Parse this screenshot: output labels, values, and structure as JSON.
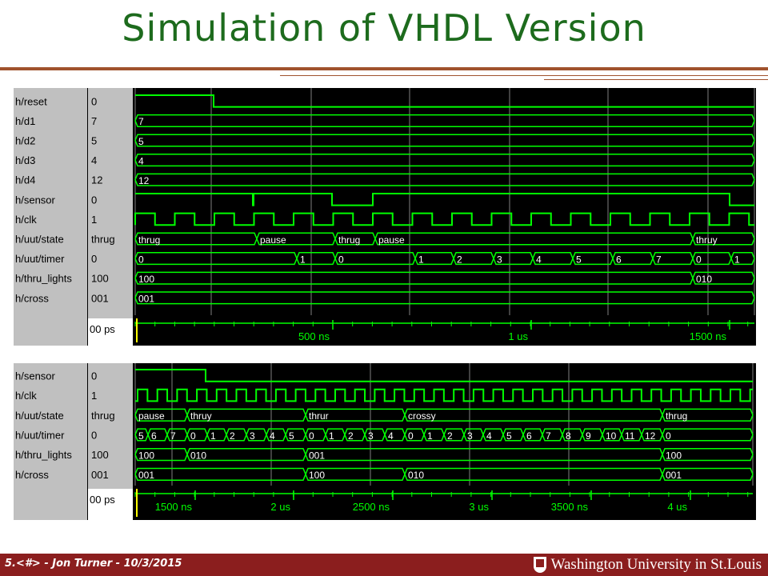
{
  "slide": {
    "title": "Simulation of VHDL Version",
    "footer": "5.<#> - Jon Turner - 10/3/2015",
    "institution": "Washington University in St.Louis"
  },
  "colors": {
    "wave": "#00ff00",
    "title": "#1d6b1d",
    "accent": "#a0522d",
    "footer": "#8b1e1e"
  },
  "panels": [
    {
      "id": "top",
      "signals": [
        {
          "name": "h/reset",
          "value": "0",
          "kind": "bit",
          "edges": [
            [
              0,
              1
            ],
            [
              98,
              0
            ]
          ]
        },
        {
          "name": "h/d1",
          "value": "7",
          "kind": "bus",
          "segs": [
            [
              0,
              "7"
            ]
          ]
        },
        {
          "name": "h/d2",
          "value": "5",
          "kind": "bus",
          "segs": [
            [
              0,
              "5"
            ]
          ]
        },
        {
          "name": "h/d3",
          "value": "4",
          "kind": "bus",
          "segs": [
            [
              0,
              "4"
            ]
          ]
        },
        {
          "name": "h/d4",
          "value": "12",
          "kind": "bus",
          "segs": [
            [
              0,
              "12"
            ]
          ]
        },
        {
          "name": "h/sensor",
          "value": "0",
          "kind": "bit",
          "edges": [
            [
              0,
              1
            ],
            [
              147,
              0
            ],
            [
              148,
              1
            ],
            [
              246,
              0
            ],
            [
              297,
              1
            ],
            [
              743,
              0
            ]
          ]
        },
        {
          "name": "h/clk",
          "value": "1",
          "kind": "clock",
          "start": 0,
          "period": 49.5
        },
        {
          "name": "h/uut/state",
          "value": "thrug",
          "kind": "bus",
          "segs": [
            [
              0,
              "thrug"
            ],
            [
              152,
              "pause"
            ],
            [
              250,
              "thrug"
            ],
            [
              300,
              "pause"
            ],
            [
              697,
              "thruy"
            ]
          ]
        },
        {
          "name": "h/uut/timer",
          "value": "0",
          "kind": "bus",
          "segs": [
            [
              0,
              "0"
            ],
            [
              202,
              "1"
            ],
            [
              250,
              "0"
            ],
            [
              350,
              "1"
            ],
            [
              398,
              "2"
            ],
            [
              448,
              "3"
            ],
            [
              497,
              "4"
            ],
            [
              547,
              "5"
            ],
            [
              597,
              "6"
            ],
            [
              647,
              "7"
            ],
            [
              697,
              "0"
            ],
            [
              745,
              "1"
            ]
          ]
        },
        {
          "name": "h/thru_lights",
          "value": "100",
          "kind": "bus",
          "segs": [
            [
              0,
              "100"
            ],
            [
              697,
              "010"
            ]
          ]
        },
        {
          "name": "h/cross",
          "value": "001",
          "kind": "bus",
          "segs": [
            [
              0,
              "001"
            ]
          ]
        }
      ],
      "time": {
        "cursor": "00 ps",
        "ticks": [
          {
            "at": 247,
            "label": "500 ns"
          },
          {
            "at": 495,
            "label": "1 us"
          },
          {
            "at": 743,
            "label": "1500 ns"
          }
        ]
      }
    },
    {
      "id": "bottom",
      "signals": [
        {
          "name": "h/sensor",
          "value": "0",
          "kind": "bit",
          "edges": [
            [
              0,
              1
            ],
            [
              88,
              0
            ]
          ]
        },
        {
          "name": "h/clk",
          "value": "1",
          "kind": "clock",
          "start": 3,
          "period": 24.7
        },
        {
          "name": "h/uut/state",
          "value": "thrug",
          "kind": "bus",
          "segs": [
            [
              0,
              "pause"
            ],
            [
              65,
              "thruy"
            ],
            [
              213,
              "thrur"
            ],
            [
              337,
              "crossy"
            ],
            [
              659,
              "thrug"
            ]
          ]
        },
        {
          "name": "h/uut/timer",
          "value": "0",
          "kind": "bus",
          "segs": [
            [
              0,
              "5"
            ],
            [
              16,
              "6"
            ],
            [
              40,
              "7"
            ],
            [
              65,
              "0"
            ],
            [
              90,
              "1"
            ],
            [
              114,
              "2"
            ],
            [
              139,
              "3"
            ],
            [
              164,
              "4"
            ],
            [
              188,
              "5"
            ],
            [
              213,
              "0"
            ],
            [
              238,
              "1"
            ],
            [
              262,
              "2"
            ],
            [
              287,
              "3"
            ],
            [
              312,
              "4"
            ],
            [
              337,
              "0"
            ],
            [
              361,
              "1"
            ],
            [
              386,
              "2"
            ],
            [
              411,
              "3"
            ],
            [
              435,
              "4"
            ],
            [
              460,
              "5"
            ],
            [
              485,
              "6"
            ],
            [
              509,
              "7"
            ],
            [
              534,
              "8"
            ],
            [
              559,
              "9"
            ],
            [
              584,
              "10"
            ],
            [
              608,
              "11"
            ],
            [
              633,
              "12"
            ],
            [
              659,
              "0"
            ]
          ]
        },
        {
          "name": "h/thru_lights",
          "value": "100",
          "kind": "bus",
          "segs": [
            [
              0,
              "100"
            ],
            [
              65,
              "010"
            ],
            [
              213,
              "001"
            ],
            [
              659,
              "100"
            ]
          ]
        },
        {
          "name": "h/cross",
          "value": "001",
          "kind": "bus",
          "segs": [
            [
              0,
              "001"
            ],
            [
              213,
              "100"
            ],
            [
              337,
              "010"
            ],
            [
              659,
              "001"
            ]
          ]
        }
      ],
      "time": {
        "cursor": "00 ps",
        "ticks": [
          {
            "at": 75,
            "label": "1500 ns"
          },
          {
            "at": 198,
            "label": "2 us"
          },
          {
            "at": 322,
            "label": "2500 ns"
          },
          {
            "at": 446,
            "label": "3 us"
          },
          {
            "at": 570,
            "label": "3500 ns"
          },
          {
            "at": 694,
            "label": "4 us"
          }
        ]
      }
    }
  ]
}
